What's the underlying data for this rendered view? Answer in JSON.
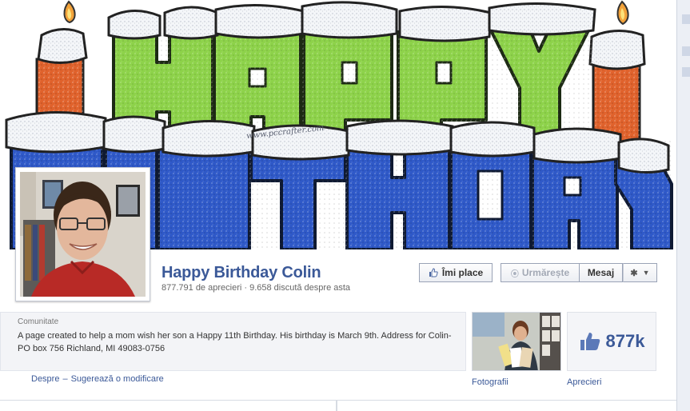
{
  "page": {
    "title": "Happy Birthday Colin",
    "stats": "877.791 de aprecieri · 9.658 discută despre asta",
    "category": "Comunitate",
    "about": "A page created to help a mom wish her son a Happy 11th Birthday. His birthday is March 9th. Address for Colin- PO box 756 Richland, MI 49083-0756"
  },
  "cover": {
    "top_word": "HAPPY",
    "bottom_word": "BIRTHDAY",
    "watermark": "www.pccrafter.com"
  },
  "actions": {
    "like": "Îmi place",
    "follow": "Urmărește",
    "message": "Mesaj",
    "settings_icon": "gear-icon"
  },
  "links": {
    "about": "Despre",
    "separator": "–",
    "suggest_edit": "Sugerează o modificare"
  },
  "tiles": {
    "photos_label": "Fotografii",
    "likes_label": "Aprecieri",
    "likes_count": "877k"
  },
  "colors": {
    "brand": "#3b5998",
    "cover_green": "#8dd24a",
    "cover_blue": "#2f59c8",
    "candle_orange": "#e0622c"
  }
}
